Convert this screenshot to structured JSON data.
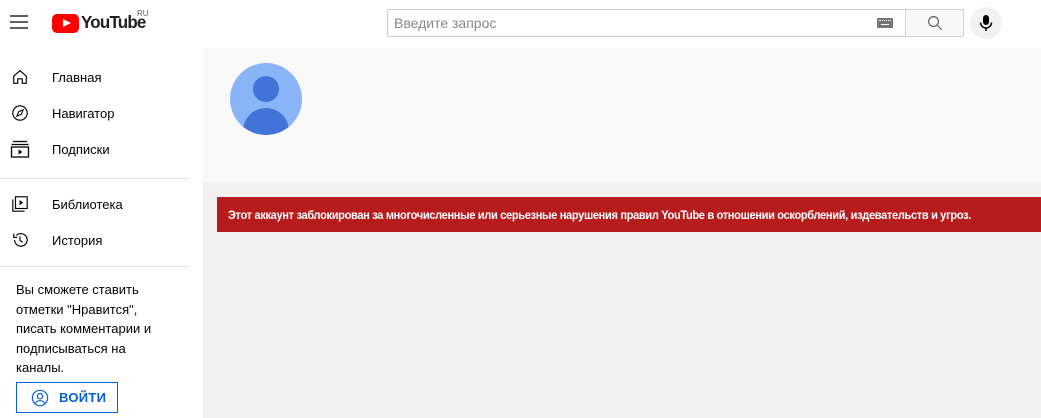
{
  "header": {
    "logo_text": "YouTube",
    "country_code": "RU",
    "search_placeholder": "Введите запрос"
  },
  "sidebar": {
    "items": [
      {
        "label": "Главная",
        "icon": "home-icon"
      },
      {
        "label": "Навигатор",
        "icon": "compass-icon"
      },
      {
        "label": "Подписки",
        "icon": "subscriptions-icon"
      },
      {
        "label": "Библиотека",
        "icon": "library-icon"
      },
      {
        "label": "История",
        "icon": "history-icon"
      }
    ],
    "signin_prompt": "Вы сможете ставить отметки \"Нравится\", писать комментарии и подписываться на каналы.",
    "signin_button": "ВОЙТИ"
  },
  "main": {
    "alert_text": "Этот аккаунт заблокирован за многочисленные или серьезные нарушения правил YouTube в отношении оскорблений, издевательств и угроз."
  },
  "colors": {
    "brand_red": "#ff0000",
    "alert_bg": "#b71c1c",
    "link_blue": "#065fd4",
    "avatar_bg": "#8ab4f8",
    "avatar_fg": "#4274d7"
  }
}
